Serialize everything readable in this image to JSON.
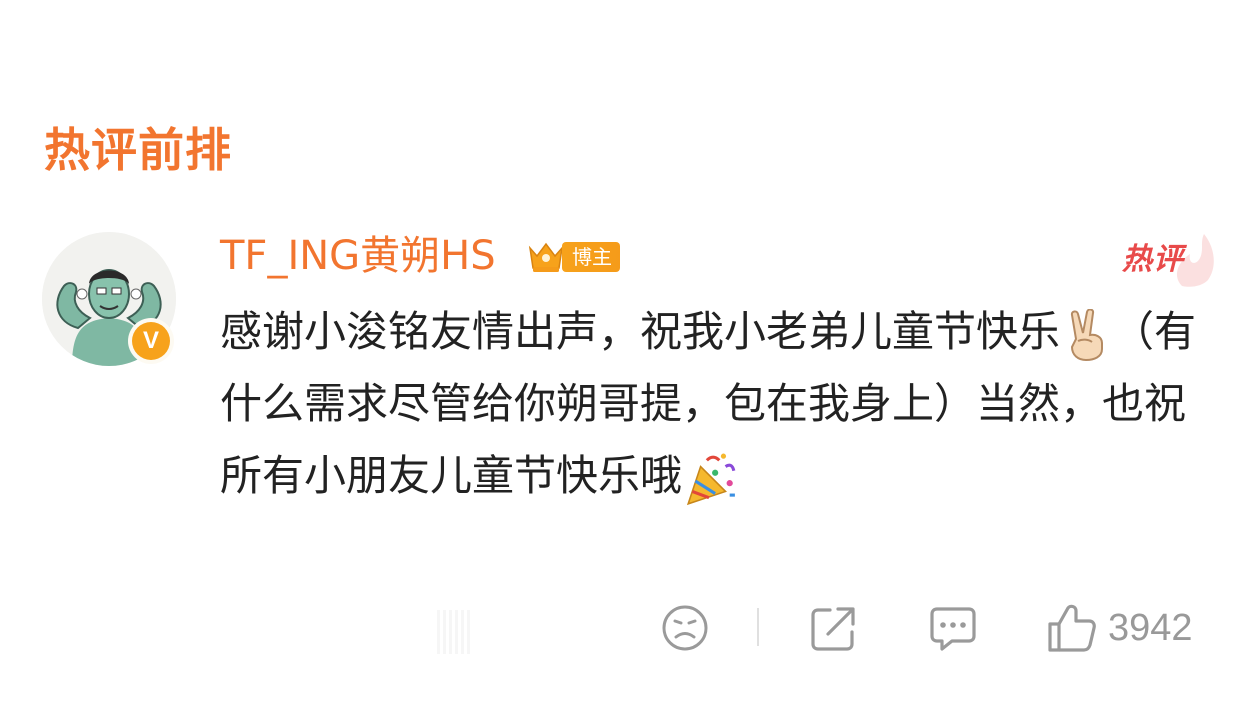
{
  "section": {
    "title": "热评前排"
  },
  "comment": {
    "username": "TF_ING黄朔HS",
    "verified_letter": "V",
    "blogger_label": "博主",
    "hot_label": "热评",
    "text_part1": "感谢小浚铭友情出声，祝我小老弟儿童节快乐",
    "text_part2": "（有什么需求尽管给你朔哥提，包在我身上）当然，也祝所有小朋友儿童节快乐哦",
    "emoji_1": "victory-hand-emoji",
    "emoji_2": "party-popper-emoji"
  },
  "actions": {
    "like_count": "3942",
    "icons": [
      "sad-face-icon",
      "share-icon",
      "comment-icon",
      "thumbs-up-icon"
    ]
  },
  "colors": {
    "accent_orange": "#f2752f",
    "hot_red": "#e84a4a",
    "badge_gold": "#f7a21b",
    "text": "#222222",
    "muted": "#999999"
  }
}
